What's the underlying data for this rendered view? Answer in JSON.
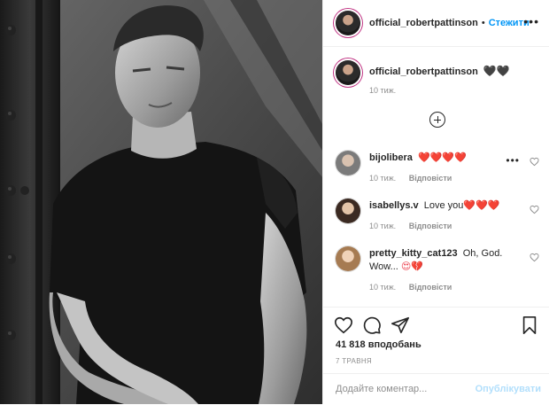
{
  "post": {
    "author": "official_robertpattinson",
    "separator": "•",
    "follow_label": "Стежити",
    "more_label": "•••",
    "caption_hearts": "🖤🖤",
    "caption_time": "10 тиж."
  },
  "comments": [
    {
      "user": "bijolibera",
      "text": "",
      "hearts": "❤️❤️❤️❤️",
      "time": "10 тиж.",
      "reply": "Відповісти",
      "options": "•••"
    },
    {
      "user": "isabellys.v",
      "text": "Love you",
      "hearts": "❤️❤️❤️",
      "time": "10 тиж.",
      "reply": "Відповісти"
    },
    {
      "user": "pretty_kitty_cat123",
      "text": "Oh, God. Wow... ",
      "hearts": "😍💔",
      "time": "10 тиж.",
      "reply": "Відповісти"
    }
  ],
  "stats": {
    "likes": "41 818 вподобань",
    "date": "7 ТРАВНЯ"
  },
  "composer": {
    "placeholder": "Додайте коментар...",
    "publish_label": "Опублікувати"
  },
  "colors": {
    "accent": "#0095f6",
    "text": "#262626",
    "muted": "#8e8e8e",
    "like_red": "#ed4956"
  },
  "icons": [
    "more-options-icon",
    "add-comments-icon",
    "heart-icon",
    "comment-icon",
    "share-icon",
    "bookmark-icon"
  ]
}
